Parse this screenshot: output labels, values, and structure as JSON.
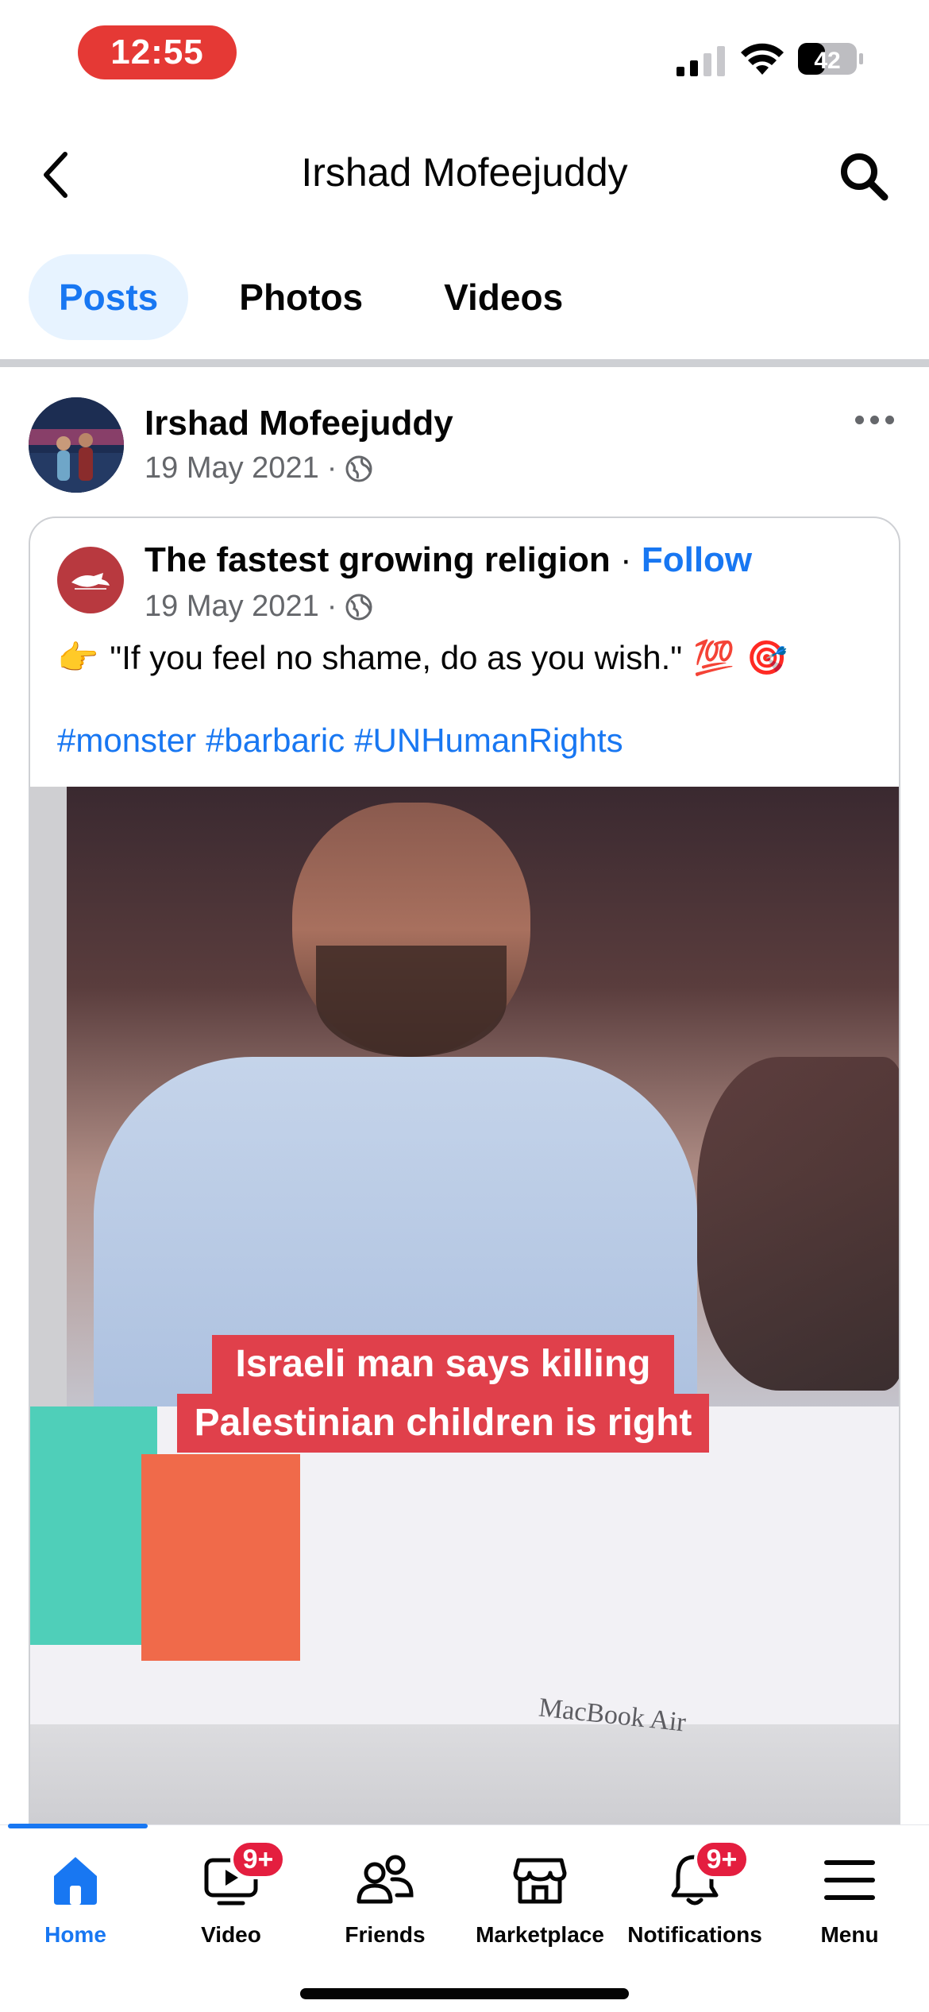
{
  "status_bar": {
    "time": "12:55",
    "battery": "42"
  },
  "header": {
    "title": "Irshad Mofeejuddy"
  },
  "tabs": [
    {
      "label": "Posts",
      "active": true
    },
    {
      "label": "Photos",
      "active": false
    },
    {
      "label": "Videos",
      "active": false
    }
  ],
  "post": {
    "author": "Irshad Mofeejuddy",
    "date": "19 May 2021",
    "shared": {
      "page_name": "The fastest growing religion",
      "follow_label": "Follow",
      "date": "19 May 2021",
      "text": "\"If you feel no shame, do as you wish.\"",
      "emoji_pointer": "👉",
      "emoji_hundred": "💯",
      "emoji_target": "🎯",
      "hashtags": [
        "#monster",
        "#barbaric",
        "#UNHumanRights"
      ],
      "video": {
        "caption_line1": "Israeli man says killing",
        "caption_line2": "Palestinian  children is right",
        "brand_text": "MacBook Air"
      }
    }
  },
  "bottom_nav": [
    {
      "label": "Home",
      "icon": "home-icon",
      "active": true
    },
    {
      "label": "Video",
      "icon": "video-icon",
      "badge": "9+"
    },
    {
      "label": "Friends",
      "icon": "friends-icon"
    },
    {
      "label": "Marketplace",
      "icon": "marketplace-icon"
    },
    {
      "label": "Notifications",
      "icon": "bell-icon",
      "badge": "9+"
    },
    {
      "label": "Menu",
      "icon": "menu-icon"
    }
  ],
  "colors": {
    "accent": "#1877f2",
    "badge": "#e41e3f",
    "time_pill": "#e53935"
  }
}
